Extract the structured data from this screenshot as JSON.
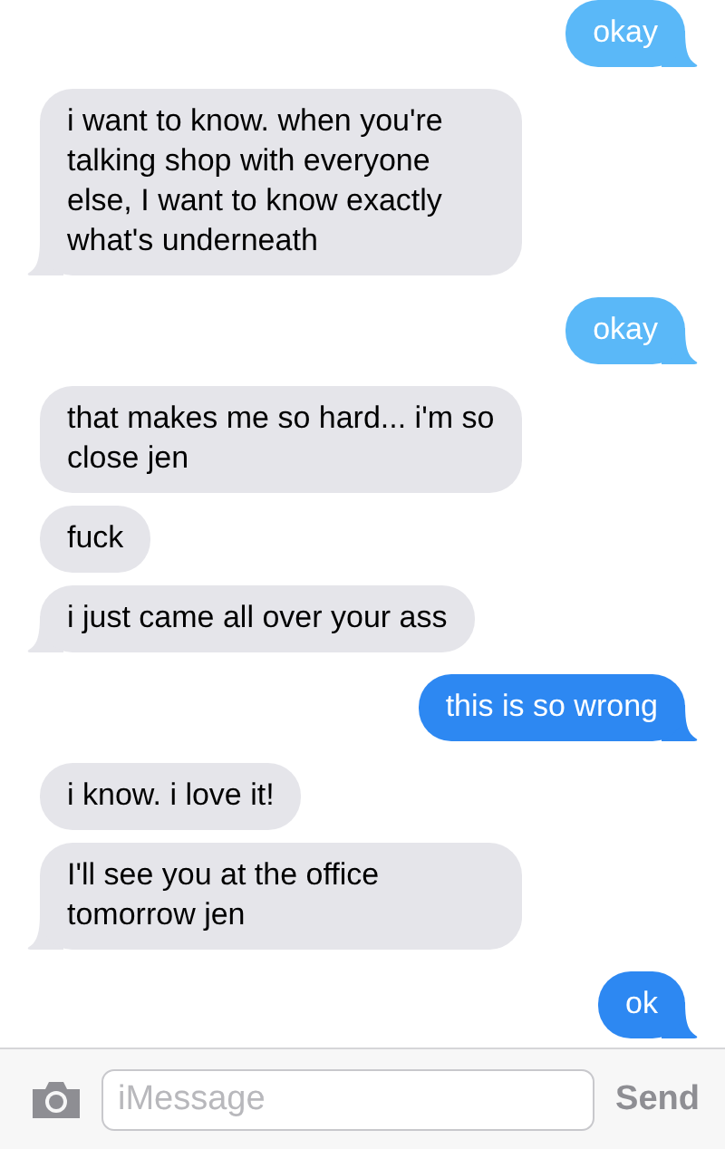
{
  "messages": [
    {
      "kind": "sent",
      "text": "okay",
      "tail": true,
      "color": "#5ab8f8"
    },
    {
      "kind": "received",
      "text": "i want to know. when you're talking shop with everyone else, I want to know exactly what's underneath",
      "tail": true,
      "color": "#e5e5ea"
    },
    {
      "kind": "sent",
      "text": "okay",
      "tail": true,
      "color": "#5ab8f8"
    },
    {
      "kind": "received",
      "text": "that makes me so hard... i'm so close jen",
      "tail": false,
      "color": "#e5e5ea"
    },
    {
      "kind": "received",
      "text": "fuck",
      "tail": false,
      "color": "#e5e5ea"
    },
    {
      "kind": "received",
      "text": "i just came all over your ass",
      "tail": true,
      "color": "#e5e5ea"
    },
    {
      "kind": "sent",
      "text": "this is so wrong",
      "tail": true,
      "color": "#2d88f2"
    },
    {
      "kind": "received",
      "text": "i know. i love it!",
      "tail": false,
      "color": "#e5e5ea"
    },
    {
      "kind": "received",
      "text": "I'll see you at the office tomorrow jen",
      "tail": true,
      "color": "#e5e5ea"
    },
    {
      "kind": "sent",
      "text": "ok",
      "tail": true,
      "color": "#2d88f2"
    }
  ],
  "compose": {
    "placeholder": "iMessage",
    "send": "Send"
  }
}
